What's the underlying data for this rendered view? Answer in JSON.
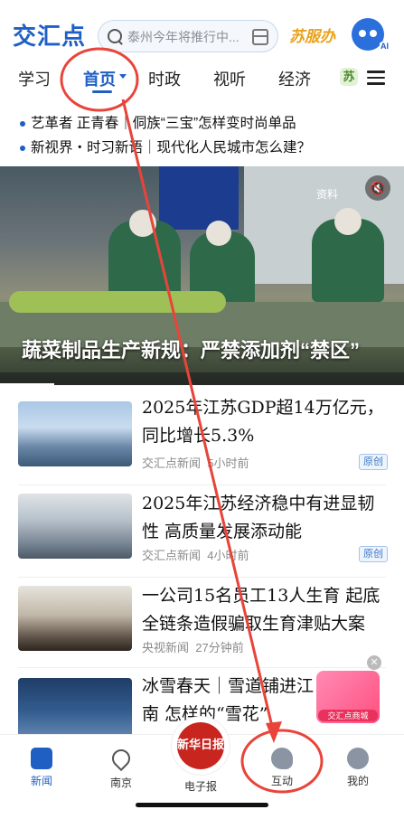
{
  "header": {
    "logo": "交汇点",
    "search_placeholder": "泰州今年将推行中...",
    "sufu_label": "苏服办",
    "ai_label": "AI"
  },
  "tabs": [
    {
      "label": "学习",
      "active": false
    },
    {
      "label": "首页",
      "active": true
    },
    {
      "label": "时政",
      "active": false
    },
    {
      "label": "视听",
      "active": false
    },
    {
      "label": "经济",
      "active": false
    },
    {
      "label": "苏",
      "active": false
    }
  ],
  "tickers": [
    "艺革者 正青春｜侗族“三宝”怎样变时尚单品",
    "新视界・时习新语｜现代化人民城市怎么建？"
  ],
  "hero": {
    "title": "蔬菜制品生产新规：严禁添加剂“禁区”",
    "tag": "资料"
  },
  "news": [
    {
      "headline": "2025年江苏GDP超14万亿元，同比增长5.3%",
      "source": "交汇点新闻",
      "time": "5小时前",
      "badge": "原创"
    },
    {
      "headline": "2025年江苏经济稳中有进显韧性 高质量发展添动能",
      "source": "交汇点新闻",
      "time": "4小时前",
      "badge": "原创"
    },
    {
      "headline": "一公司15名员工13人生育 起底全链条造假骗取生育津贴大案",
      "source": "央视新闻",
      "time": "27分钟前",
      "badge": ""
    },
    {
      "headline": "冰雪春天｜雪道铺进江南 怎样的“雪花”",
      "source": "交汇点新闻",
      "time": "小时前",
      "badge": ""
    }
  ],
  "float_ad": {
    "label": "交汇点商城"
  },
  "bottom_nav": {
    "items": [
      {
        "label": "新闻",
        "active": true
      },
      {
        "label": "南京",
        "active": false
      },
      {
        "label": "互动",
        "active": false
      },
      {
        "label": "我的",
        "active": false
      }
    ],
    "center_logo": "新华日报",
    "center_label": "电子报"
  },
  "colors": {
    "brand": "#1f5fc4",
    "annotation": "#e8443a"
  }
}
